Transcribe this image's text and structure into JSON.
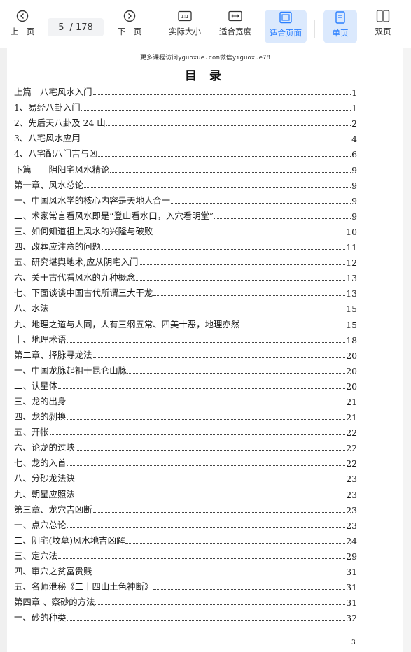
{
  "toolbar": {
    "prev_label": "上一页",
    "next_label": "下一页",
    "current_page": "5",
    "total_pages": "/ 178",
    "actual_size_label": "实际大小",
    "actual_size_icon_text": "1:1",
    "fit_width_label": "适合宽度",
    "fit_page_label": "适合页面",
    "single_label": "单页",
    "double_label": "双页",
    "accent_color": "#2a7fff"
  },
  "document": {
    "watermark": "更多课程访问yguoxue.com微信yiguoxue78",
    "title": "目  录",
    "footer_page": "3",
    "toc": [
      {
        "text": "上篇　八宅风水入门",
        "page": "1"
      },
      {
        "text": "1、易经八卦入门",
        "page": "1"
      },
      {
        "text": "2、先后天八卦及 24 山",
        "page": "2"
      },
      {
        "text": "3、八宅风水应用",
        "page": "4"
      },
      {
        "text": "4、八宅配八门吉与凶",
        "page": "6"
      },
      {
        "text": "下篇　　阴阳宅风水精论",
        "page": "9"
      },
      {
        "text": "第一章、风水总论",
        "page": "9"
      },
      {
        "text": "一、中国风水学的核心内容是天地人合一",
        "page": "9"
      },
      {
        "text": "二、术家常言看风水即是“登山看水口，入穴看明堂”",
        "page": "9"
      },
      {
        "text": "三、如何知道祖上风水的兴隆与破败",
        "page": "10"
      },
      {
        "text": "四、改葬应注意的问题",
        "page": "11"
      },
      {
        "text": "五、研究堪舆地术,应从阴宅入门",
        "page": "12"
      },
      {
        "text": "六、关于古代看风水的九种概念",
        "page": "13"
      },
      {
        "text": "七、下面谈谈中国古代所谓三大干龙",
        "page": "13"
      },
      {
        "text": "八、水法",
        "page": "15"
      },
      {
        "text": "九、地理之道与人同，人有三纲五常、四美十恶，地理亦然",
        "page": "15"
      },
      {
        "text": "十、地理术语",
        "page": "18"
      },
      {
        "text": "第二章、择脉寻龙法",
        "page": "20"
      },
      {
        "text": "一、中国龙脉起祖于昆仑山脉",
        "page": "20"
      },
      {
        "text": "二、认星体",
        "page": "20"
      },
      {
        "text": "三、龙的出身",
        "page": "21"
      },
      {
        "text": "四、龙的剥换",
        "page": "21"
      },
      {
        "text": "五、开帐",
        "page": "22"
      },
      {
        "text": "六、论龙的过峡",
        "page": "22"
      },
      {
        "text": "七、龙的入首",
        "page": "22"
      },
      {
        "text": "八、分砂龙法诀",
        "page": "23"
      },
      {
        "text": "九、朝星应照法",
        "page": "23"
      },
      {
        "text": "第三章、龙穴吉凶断",
        "page": "23"
      },
      {
        "text": "一、点穴总论",
        "page": "23"
      },
      {
        "text": "二、阴宅(坟墓)风水地吉凶解",
        "page": "24"
      },
      {
        "text": "三、定穴法",
        "page": "29"
      },
      {
        "text": "四、审穴之贫富贵贱",
        "page": "31"
      },
      {
        "text": "五、名师泄秘《二十四山土色神断》",
        "page": "31"
      },
      {
        "text": "第四章 、察砂的方法",
        "page": "31"
      },
      {
        "text": "一、砂的种类",
        "page": "32"
      }
    ]
  }
}
